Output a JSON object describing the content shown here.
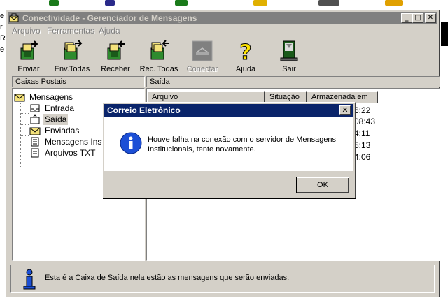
{
  "background": {
    "side_letters": [
      "e",
      "r",
      "Rl",
      "e"
    ]
  },
  "window": {
    "title": "Conectividade - Gerenciador de Mensagens",
    "controls": {
      "minimize": "_",
      "maximize": "□",
      "close": "✕"
    }
  },
  "menu": [
    "Arquivo",
    "Ferramentas",
    "Ajuda"
  ],
  "toolbar": [
    {
      "label": "Enviar",
      "icon": "send-icon",
      "enabled": true
    },
    {
      "label": "Env.Todas",
      "icon": "send-all-icon",
      "enabled": true
    },
    {
      "label": "Receber",
      "icon": "receive-icon",
      "enabled": true
    },
    {
      "label": "Rec. Todas",
      "icon": "receive-all-icon",
      "enabled": true
    },
    {
      "label": "Conectar",
      "icon": "connect-icon",
      "enabled": false
    },
    {
      "label": "Ajuda",
      "icon": "help-icon",
      "enabled": true
    },
    {
      "label": "Sair",
      "icon": "exit-icon",
      "enabled": true
    }
  ],
  "left_pane": {
    "header": "Caixas Postais",
    "root": "Mensagens",
    "items": [
      "Entrada",
      "Saída",
      "Enviadas",
      "Mensagens Instituc",
      "Arquivos TXT"
    ],
    "selected": "Saída"
  },
  "right_pane": {
    "header": "Saída",
    "columns": [
      "Arquivo",
      "Situação",
      "Armazenada em"
    ],
    "visible_times": [
      "6:22",
      "08:43",
      "4:11",
      "5:13",
      "4:06"
    ]
  },
  "status_bar": {
    "text": "Esta é a Caixa de Saída nela estão as mensagens que serão enviadas."
  },
  "dialog": {
    "title": "Correio Eletrônico",
    "close": "✕",
    "message": "Houve falha na conexão com o servidor de Mensagens Institucionais, tente novamente.",
    "ok_label": "OK"
  },
  "colors": {
    "inactive_title": "#808080",
    "active_title": "#0a246a",
    "face": "#d4d0c8",
    "info_icon": "#1c4fd6"
  }
}
